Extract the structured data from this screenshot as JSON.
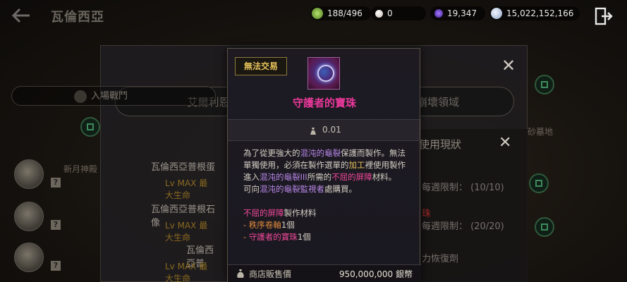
{
  "header": {
    "back_icon": "back-arrow-icon",
    "title": "瓦倫西亞",
    "resources": [
      {
        "icon": "energy-icon",
        "value": "188/496",
        "color": "#7cb342"
      },
      {
        "icon": "pearl-icon",
        "value": "0",
        "color": "#d8c8c0"
      },
      {
        "icon": "crystal-icon",
        "value": "19,347",
        "color": "#6a3bd0"
      },
      {
        "icon": "silver-icon",
        "value": "15,022,152,166",
        "color": "#b8c8e0"
      }
    ],
    "exit_icon": "exit-door-icon"
  },
  "panel": {
    "tab_left": "艾爾利恩神",
    "tab_right": "崩壞領域",
    "subheader": "入場戰鬥",
    "rows": [
      {
        "name": "瓦倫西亞普根蛋",
        "level": "Lv MAX 最大生命"
      },
      {
        "name": "瓦倫西亞普根石像",
        "level": "Lv MAX 最大生命"
      },
      {
        "name": "瓦倫西亞普",
        "level": "Lv MAX 最大生命"
      }
    ],
    "side": {
      "title": "使用現狀",
      "line1": "每週限制： (10/10)",
      "red": "珠",
      "line2": "每週限制： (20/20)",
      "line3": "力恢復劑"
    },
    "map_labels": {
      "left": "新月神殿",
      "right": "砂墓地"
    }
  },
  "tooltip": {
    "badge": "無法交易",
    "item_name": "守護者的寶珠",
    "weight": "0.01",
    "desc": {
      "p1_a": "為了從更強大的",
      "p1_b": "混沌的龜裂",
      "p1_c": "保護而製作。無法單獨使用，必須在製作選單的",
      "p1_d": "加工",
      "p1_e": "裡使用製作進入",
      "p1_f": "混沌的龜裂III",
      "p1_g": "所需的",
      "p1_h": "不屈的屏障",
      "p1_i": "材料。",
      "p2_a": "可向",
      "p2_b": "混沌的龜裂監視者",
      "p2_c": "處購買。",
      "p3_a": "不屈的屏障",
      "p3_b": "製作材料",
      "p3_c": " - ",
      "p3_d": "秩序卷軸",
      "p3_e": "1個",
      "p3_f": " - ",
      "p3_g": "守護者的寶珠",
      "p3_h": "1個"
    },
    "price_label": "商店販售價",
    "price_value": "950,000,000 銀幣"
  }
}
